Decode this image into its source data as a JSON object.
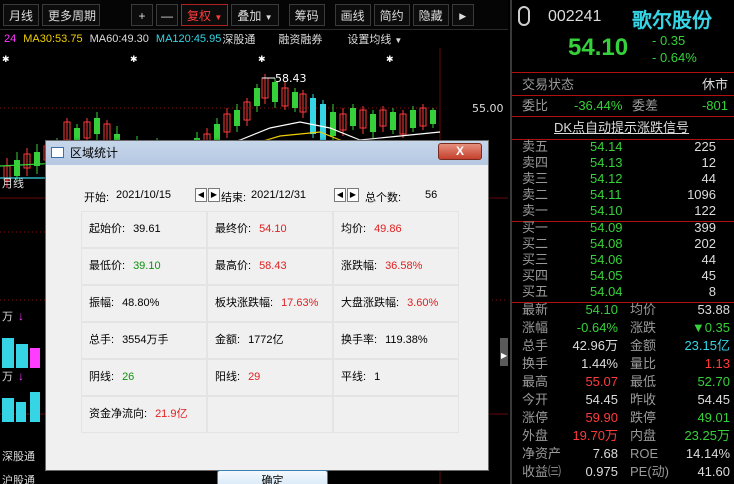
{
  "toolbar": {
    "items": [
      "月线",
      "更多周期",
      "+",
      "—",
      "复权",
      "叠加",
      "筹码",
      "画线",
      "简约",
      "隐藏",
      "▶"
    ],
    "add_symbol": "+"
  },
  "ma_line": {
    "ma20": "24",
    "ma30": "MA30:53.75",
    "ma60": "MA60:49.30",
    "ma120": "MA120:45.95",
    "shenggutong": "深股通",
    "rongzi": "融资融券",
    "setting": "设置均线"
  },
  "chart": {
    "high_label": "58.43",
    "price_label": "55.00",
    "left_labels": [
      "月线",
      "万",
      "深股通",
      "万",
      "沪股通"
    ]
  },
  "quote": {
    "code": "002241",
    "name": "歌尔股份",
    "price": "54.10",
    "change": "- 0.35",
    "change_pct": "- 0.64%",
    "status_label": "交易状态",
    "status_value": "休市",
    "weibi_label": "委比",
    "weibi_value": "-36.44%",
    "weicha_label": "委差",
    "weicha_value": "-801",
    "signal_link": "DK点自动提示涨跌信号",
    "sell": [
      {
        "label": "卖五",
        "price": "54.14",
        "vol": "225"
      },
      {
        "label": "卖四",
        "price": "54.13",
        "vol": "12"
      },
      {
        "label": "卖三",
        "price": "54.12",
        "vol": "44"
      },
      {
        "label": "卖二",
        "price": "54.11",
        "vol": "1096"
      },
      {
        "label": "卖一",
        "price": "54.10",
        "vol": "122"
      }
    ],
    "buy": [
      {
        "label": "买一",
        "price": "54.09",
        "vol": "399"
      },
      {
        "label": "买二",
        "price": "54.08",
        "vol": "202"
      },
      {
        "label": "买三",
        "price": "54.06",
        "vol": "44"
      },
      {
        "label": "买四",
        "price": "54.05",
        "vol": "45"
      },
      {
        "label": "买五",
        "price": "54.04",
        "vol": "8"
      }
    ],
    "stats": [
      {
        "l1": "最新",
        "v1": "54.10",
        "c1": "g",
        "l2": "均价",
        "v2": "53.88",
        "c2": "w"
      },
      {
        "l1": "涨幅",
        "v1": "-0.64%",
        "c1": "g",
        "l2": "涨跌",
        "v2": "▼0.35",
        "c2": "g"
      },
      {
        "l1": "总手",
        "v1": "42.96万",
        "c1": "w",
        "l2": "金额",
        "v2": "23.15亿",
        "c2": "c"
      },
      {
        "l1": "换手",
        "v1": "1.44%",
        "c1": "w",
        "l2": "量比",
        "v2": "1.13",
        "c2": "r"
      },
      {
        "l1": "最高",
        "v1": "55.07",
        "c1": "r",
        "l2": "最低",
        "v2": "52.70",
        "c2": "g"
      },
      {
        "l1": "今开",
        "v1": "54.45",
        "c1": "w",
        "l2": "昨收",
        "v2": "54.45",
        "c2": "w"
      },
      {
        "l1": "涨停",
        "v1": "59.90",
        "c1": "r",
        "l2": "跌停",
        "v2": "49.01",
        "c2": "g"
      },
      {
        "l1": "外盘",
        "v1": "19.70万",
        "c1": "r",
        "l2": "内盘",
        "v2": "23.25万",
        "c2": "g"
      },
      {
        "l1": "净资产",
        "v1": "7.68",
        "c1": "w",
        "l2": "ROE",
        "v2": "14.14%",
        "c2": "w"
      },
      {
        "l1": "收益㈢",
        "v1": "0.975",
        "c1": "w",
        "l2": "PE(动)",
        "v2": "41.60",
        "c2": "w"
      }
    ]
  },
  "dialog": {
    "title": "区域统计",
    "close": "X",
    "start_label": "开始:",
    "start_value": "2021/10/15",
    "end_label": "结束:",
    "end_value": "2021/12/31",
    "count_label": "总个数:",
    "count_value": "56",
    "cells": [
      {
        "label": "起始价:",
        "value": "39.61",
        "color": "k"
      },
      {
        "label": "最终价:",
        "value": "54.10",
        "color": "r"
      },
      {
        "label": "均价:",
        "value": "49.86",
        "color": "r"
      },
      {
        "label": "最低价:",
        "value": "39.10",
        "color": "g"
      },
      {
        "label": "最高价:",
        "value": "58.43",
        "color": "r"
      },
      {
        "label": "涨跌幅:",
        "value": "36.58%",
        "color": "r"
      },
      {
        "label": "振幅:",
        "value": "48.80%",
        "color": "k"
      },
      {
        "label": "板块涨跌幅:",
        "value": "17.63%",
        "color": "r"
      },
      {
        "label": "大盘涨跌幅:",
        "value": "3.60%",
        "color": "r"
      },
      {
        "label": "总手:",
        "value": "3554万手",
        "color": "k"
      },
      {
        "label": "金额:",
        "value": "1772亿",
        "color": "k"
      },
      {
        "label": "换手率:",
        "value": "119.38%",
        "color": "k"
      },
      {
        "label": "阴线:",
        "value": "26",
        "color": "g"
      },
      {
        "label": "阳线:",
        "value": "29",
        "color": "r"
      },
      {
        "label": "平线:",
        "value": "1",
        "color": "k"
      },
      {
        "label": "资金净流向:",
        "value": "21.9亿",
        "color": "r"
      },
      {
        "label": "",
        "value": "",
        "color": "k"
      },
      {
        "label": "",
        "value": "",
        "color": "k"
      }
    ],
    "ok_label": "确定"
  }
}
